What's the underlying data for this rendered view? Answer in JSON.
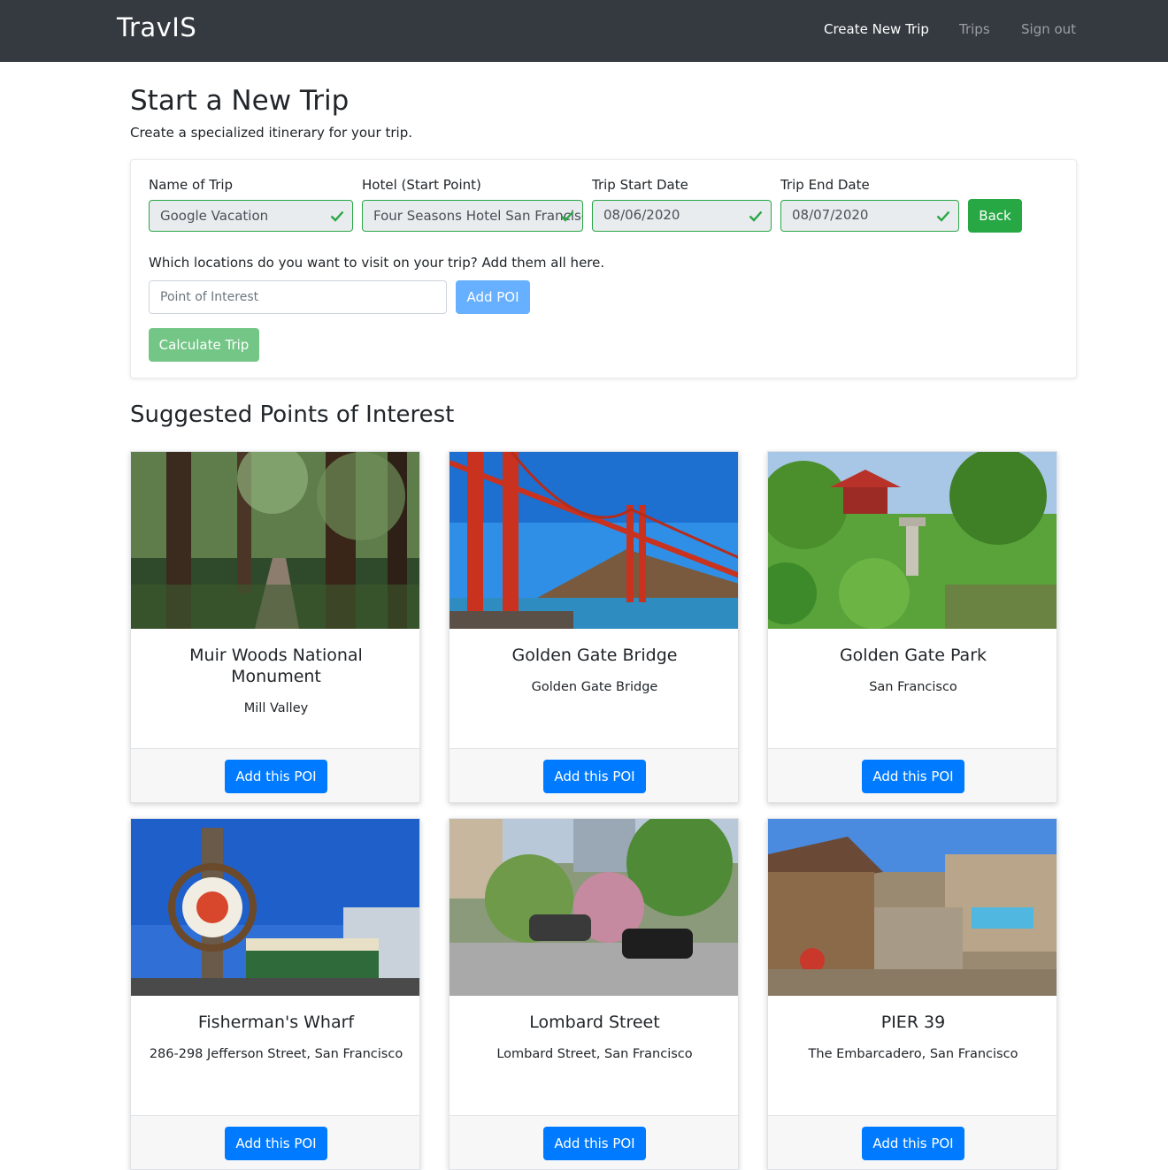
{
  "nav": {
    "brand": "TravIS",
    "links": [
      "Create New Trip",
      "Trips",
      "Sign out"
    ]
  },
  "page": {
    "title": "Start a New Trip",
    "subtitle": "Create a specialized itinerary for your trip."
  },
  "form": {
    "trip_name": {
      "label": "Name of Trip",
      "value": "Google Vacation"
    },
    "hotel": {
      "label": "Hotel (Start Point)",
      "value": "Four Seasons Hotel San Francisco"
    },
    "start_date": {
      "label": "Trip Start Date",
      "value": "08/06/2020"
    },
    "end_date": {
      "label": "Trip End Date",
      "value": "08/07/2020"
    },
    "back_label": "Back",
    "locations_prompt": "Which locations do you want to visit on your trip? Add them all here.",
    "poi_placeholder": "Point of Interest",
    "add_poi_label": "Add POI",
    "calculate_label": "Calculate Trip"
  },
  "suggested": {
    "title": "Suggested Points of Interest",
    "add_label": "Add this POI",
    "items": [
      {
        "name": "Muir Woods National Monument",
        "location": "Mill Valley"
      },
      {
        "name": "Golden Gate Bridge",
        "location": "Golden Gate Bridge"
      },
      {
        "name": "Golden Gate Park",
        "location": "San Francisco"
      },
      {
        "name": "Fisherman's Wharf",
        "location": "286-298 Jefferson Street, San Francisco"
      },
      {
        "name": "Lombard Street",
        "location": "Lombard Street, San Francisco"
      },
      {
        "name": "PIER 39",
        "location": "The Embarcadero, San Francisco"
      }
    ]
  },
  "colors": {
    "navbar": "#343a40",
    "primary": "#007bff",
    "success": "#28a745"
  }
}
